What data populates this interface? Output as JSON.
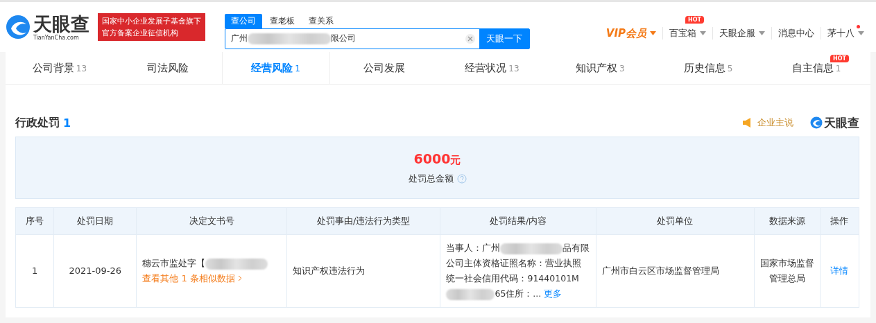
{
  "header": {
    "logo": {
      "name": "天眼查",
      "domain": "TianYanCha.com"
    },
    "banner": [
      "国家中小企业发展子基金旗下",
      "官方备案企业征信机构"
    ],
    "search": {
      "tabs": [
        {
          "label": "查公司",
          "selected": true
        },
        {
          "label": "查老板",
          "selected": false
        },
        {
          "label": "查关系",
          "selected": false
        }
      ],
      "value": [
        {
          "kind": "text",
          "text": "广州"
        },
        {
          "kind": "redacted"
        },
        {
          "kind": "text",
          "text": "限公司"
        }
      ],
      "button": "天眼一下"
    },
    "nav": [
      {
        "kind": "vip",
        "label": "VIP会员",
        "caret": true
      },
      {
        "kind": "link",
        "label": "百宝箱",
        "caret": true,
        "badge": "HOT"
      },
      {
        "kind": "link",
        "label": "天眼企服",
        "caret": true
      },
      {
        "kind": "link",
        "label": "消息中心",
        "caret": false
      },
      {
        "kind": "user",
        "label": "茅十八",
        "caret": true,
        "dot": true
      }
    ]
  },
  "tabs": [
    {
      "label": "公司背景",
      "count": "13",
      "selected": false
    },
    {
      "label": "司法风险",
      "selected": false
    },
    {
      "label": "经营风险",
      "count": "1",
      "selected": true
    },
    {
      "label": "公司发展",
      "selected": false
    },
    {
      "label": "经营状况",
      "count": "13",
      "selected": false
    },
    {
      "label": "知识产权",
      "count": "3",
      "selected": false
    },
    {
      "label": "历史信息",
      "count": "5",
      "selected": false
    },
    {
      "label": "自主信息",
      "count": "1",
      "selected": false,
      "badge": "HOT"
    }
  ],
  "section": {
    "title": "行政处罚",
    "count": "1",
    "action": "企业主说",
    "brand": "天眼查",
    "summary": {
      "amount": "6000",
      "unit": "元",
      "label": "处罚总金额"
    },
    "table": {
      "columns": [
        "序号",
        "处罚日期",
        "决定文书号",
        "处罚事由/违法行为类型",
        "处罚结果/内容",
        "处罚单位",
        "数据来源",
        "操作"
      ],
      "rows": [
        {
          "index": "1",
          "date": "2021-09-26",
          "doc": [
            {
              "kind": "text",
              "text": "穗云市监处字【"
            },
            {
              "kind": "redacted"
            }
          ],
          "similar": "查看其他 1 条相似数据",
          "reason": "知识产权违法行为",
          "result": [
            {
              "kind": "text",
              "text": "当事人：广州"
            },
            {
              "kind": "redacted"
            },
            {
              "kind": "text",
              "text": "品有限公司主体资格证照名称：营业执照统一社会信用代码：91440101M"
            },
            {
              "kind": "redacted"
            },
            {
              "kind": "text",
              "text": "65住所：..."
            }
          ],
          "more": "更多",
          "unit": "广州市白云区市场监督管理局",
          "source": "国家市场监督管理总局",
          "action": "详情"
        }
      ]
    }
  }
}
